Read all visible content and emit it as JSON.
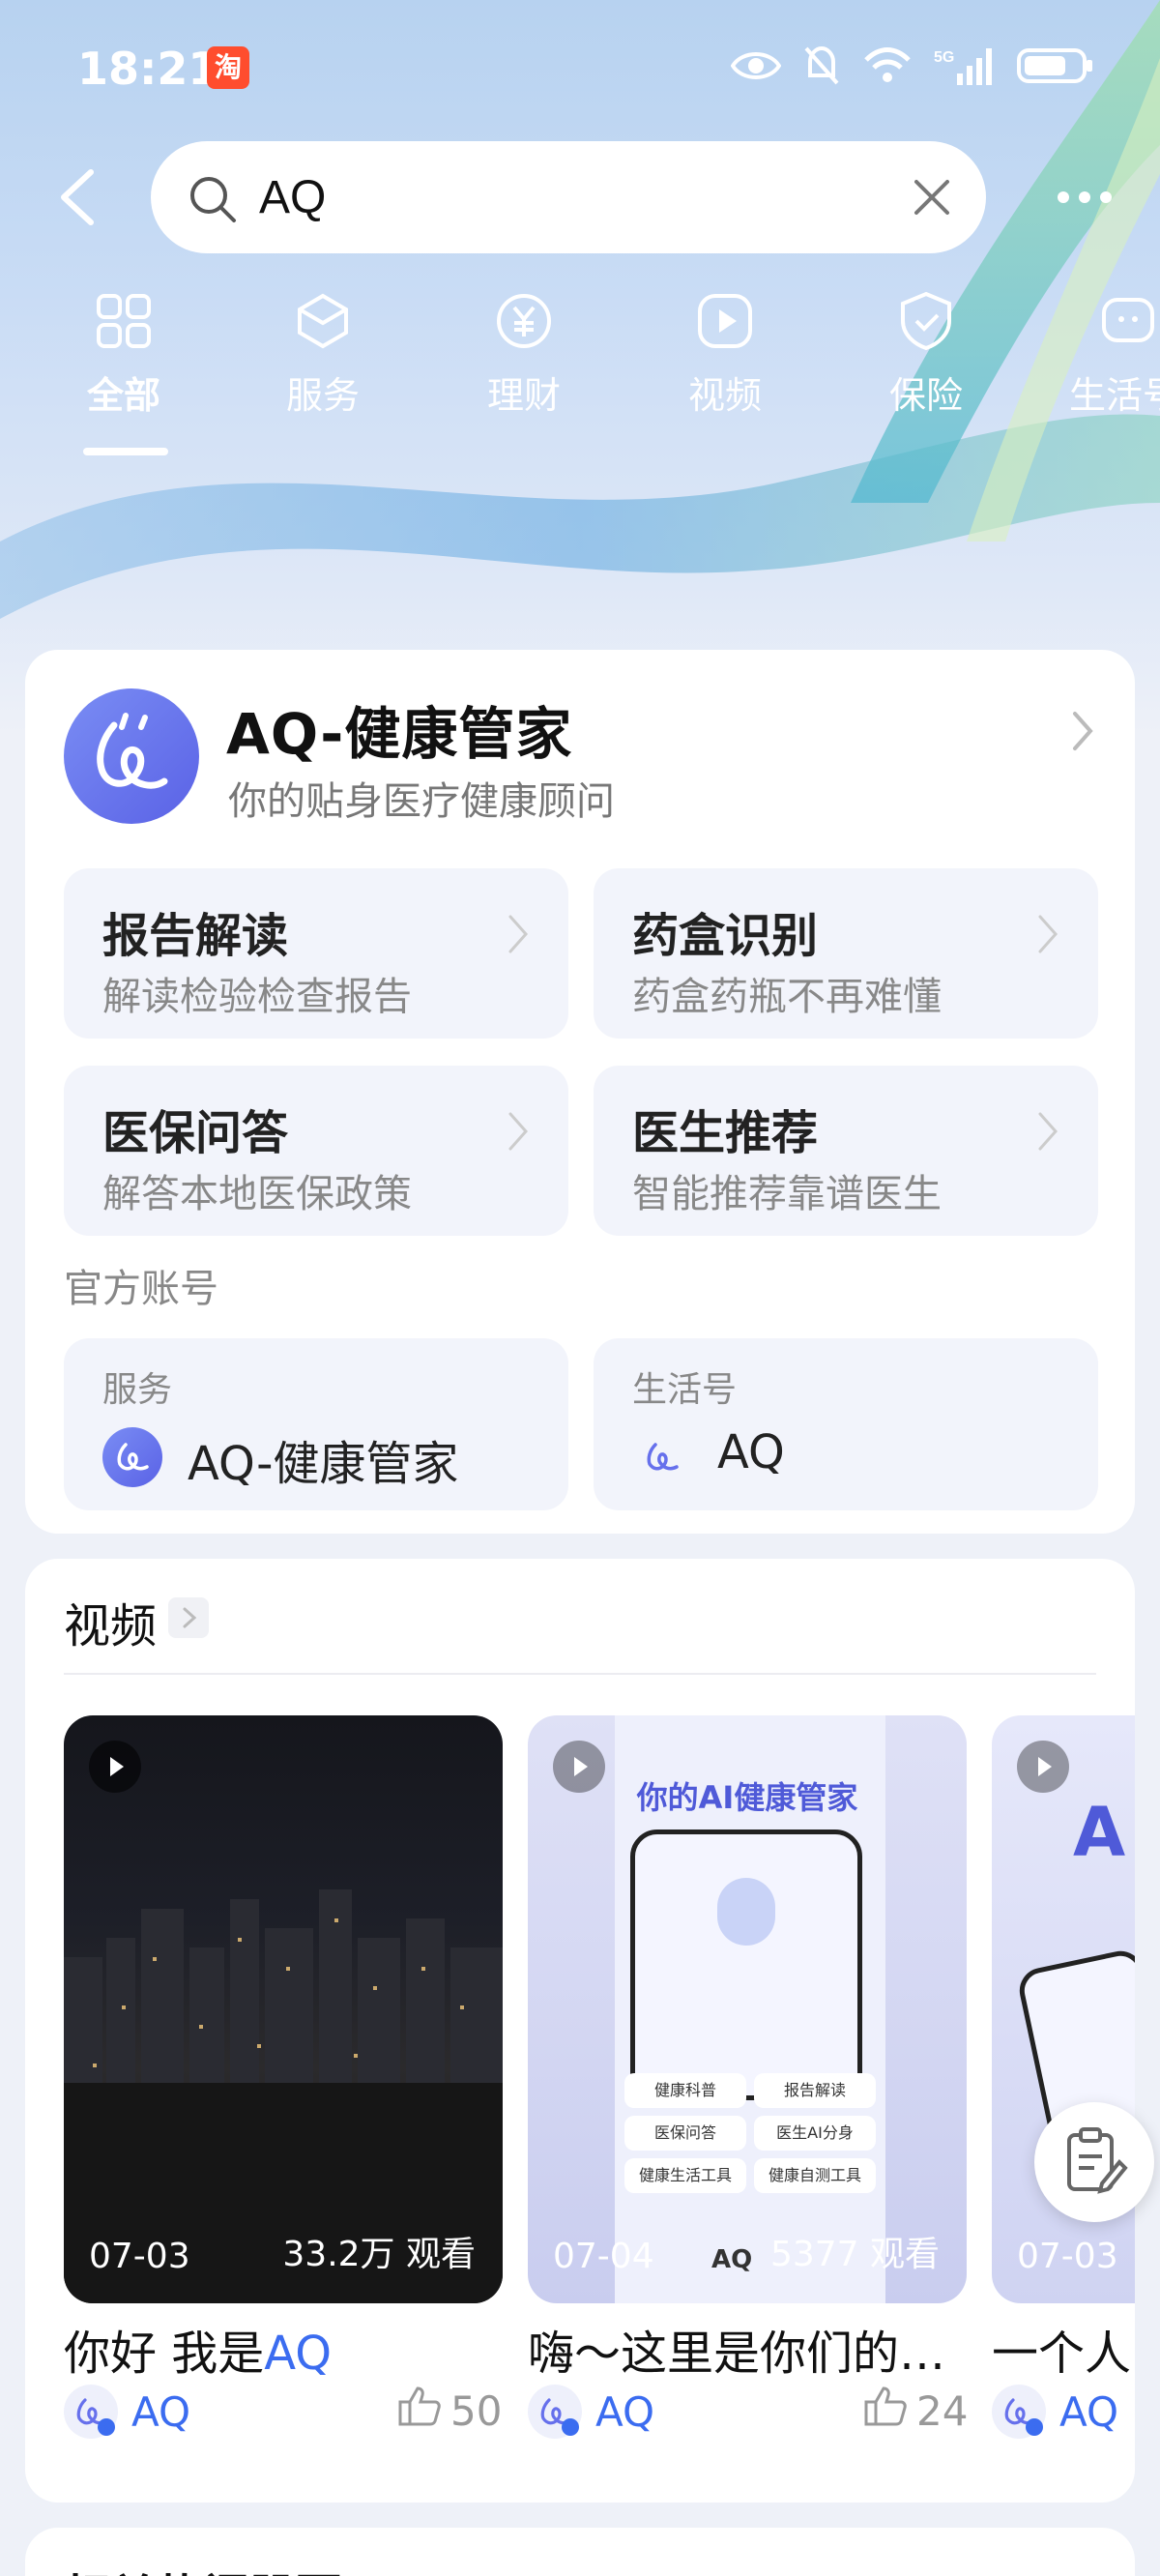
{
  "status_bar": {
    "time": "18:21",
    "app_badge": "淘",
    "network": "5G"
  },
  "search": {
    "value": "AQ",
    "placeholder": ""
  },
  "tabs": [
    {
      "label": "全部",
      "icon": "grid-icon",
      "active": true
    },
    {
      "label": "服务",
      "icon": "cube-icon",
      "active": false
    },
    {
      "label": "理财",
      "icon": "yuan-icon",
      "active": false
    },
    {
      "label": "视频",
      "icon": "play-icon",
      "active": false
    },
    {
      "label": "保险",
      "icon": "shield-icon",
      "active": false
    },
    {
      "label": "生活号",
      "icon": "chat-icon",
      "active": false
    }
  ],
  "app_card": {
    "title": "AQ-健康管家",
    "subtitle": "你的贴身医疗健康顾问",
    "features": [
      {
        "title": "报告解读",
        "subtitle": "解读检验检查报告"
      },
      {
        "title": "药盒识别",
        "subtitle": "药盒药瓶不再难懂"
      },
      {
        "title": "医保问答",
        "subtitle": "解答本地医保政策"
      },
      {
        "title": "医生推荐",
        "subtitle": "智能推荐靠谱医生"
      }
    ],
    "official_label": "官方账号",
    "accounts": [
      {
        "type": "服务",
        "name": "AQ-健康管家"
      },
      {
        "type": "生活号",
        "name": "AQ"
      }
    ]
  },
  "video_section": {
    "title": "视频",
    "videos": [
      {
        "date": "07-03",
        "views": "33.2万 观看",
        "caption_prefix": "你好 我是",
        "caption_highlight": "AQ",
        "author": "AQ",
        "likes": "50"
      },
      {
        "date": "07-04",
        "views": "5377 观看",
        "caption_prefix": "嗨～这里是你们的…",
        "caption_highlight": "",
        "author": "AQ",
        "likes": "24",
        "poster_title": "你的AI健康管家",
        "poster_items": [
          "健康科普",
          "报告解读",
          "医保问答",
          "医生AI分身",
          "健康生活工具",
          "健康自测工具"
        ],
        "poster_brand": "AQ"
      },
      {
        "date": "07-03",
        "views": "",
        "caption_prefix": "一个人",
        "caption_highlight": "",
        "author": "AQ",
        "likes": ""
      }
    ]
  },
  "next_section": {
    "title": "相关热门股票"
  },
  "colors": {
    "accent": "#3b6cf0",
    "logo": "#6670ec"
  }
}
